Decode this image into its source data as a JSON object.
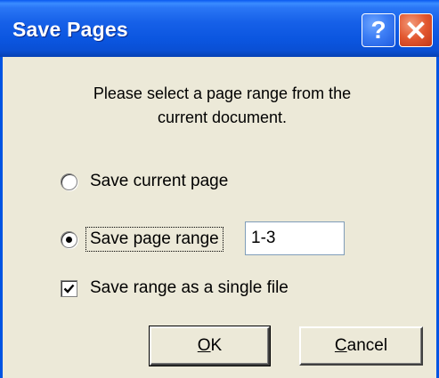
{
  "window": {
    "title": "Save Pages"
  },
  "titlebar": {
    "help_label": "?"
  },
  "message": {
    "line1": "Please select a page range from the",
    "line2": "current document."
  },
  "options": {
    "save_current_label": "Save current page",
    "save_range_label": "Save page range",
    "range_value": "1-3",
    "single_file_label": "Save range as a single file",
    "selected": "save_page_range",
    "single_file_checked": true
  },
  "buttons": {
    "ok_mnemonic": "O",
    "ok_rest": "K",
    "cancel_mnemonic": "C",
    "cancel_rest": "ancel"
  }
}
